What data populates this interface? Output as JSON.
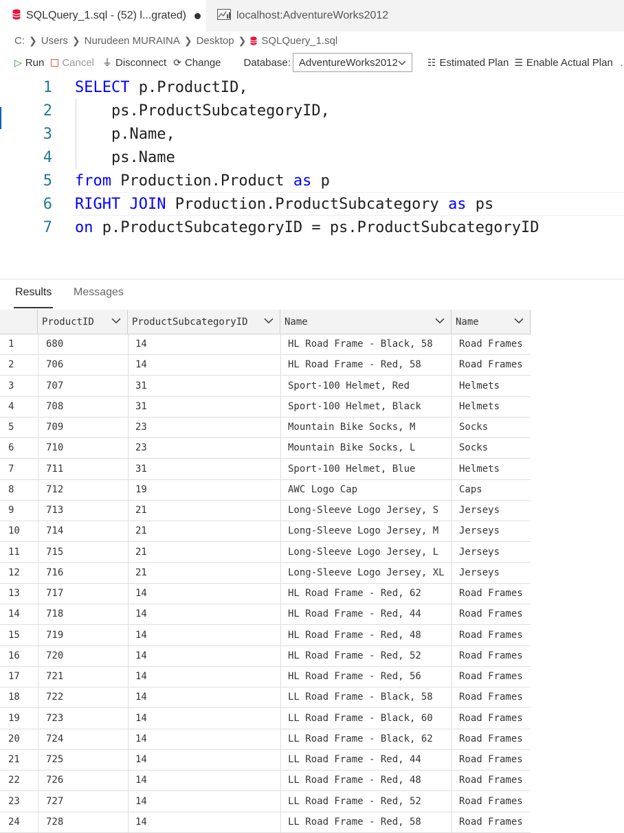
{
  "tabs": [
    {
      "label": "SQLQuery_1.sql - (52) l...grated)",
      "icon": "database-icon",
      "active": true
    },
    {
      "label": "localhost:AdventureWorks2012",
      "icon": "dashboard-icon",
      "active": false
    }
  ],
  "breadcrumb": [
    "C:",
    "Users",
    "Nurudeen MURAINA",
    "Desktop",
    "SQLQuery_1.sql"
  ],
  "toolbar": {
    "run": "Run",
    "cancel": "Cancel",
    "disconnect": "Disconnect",
    "change": "Change",
    "database_label": "Database:",
    "database_value": "AdventureWorks2012",
    "estimated_plan": "Estimated Plan",
    "enable_actual_plan": "Enable Actual Plan"
  },
  "editor": {
    "lines": [
      {
        "num": "1",
        "tokens": [
          {
            "t": "SELECT",
            "kw": true
          },
          {
            "t": " p.ProductID,",
            "kw": false
          }
        ]
      },
      {
        "num": "2",
        "tokens": [
          {
            "t": "    ps.ProductSubcategoryID,",
            "kw": false
          }
        ]
      },
      {
        "num": "3",
        "tokens": [
          {
            "t": "    p.Name,",
            "kw": false
          }
        ]
      },
      {
        "num": "4",
        "tokens": [
          {
            "t": "    ps.Name",
            "kw": false
          }
        ]
      },
      {
        "num": "5",
        "tokens": [
          {
            "t": "from",
            "kw": true
          },
          {
            "t": " Production.Product ",
            "kw": false
          },
          {
            "t": "as",
            "kw": true
          },
          {
            "t": " p",
            "kw": false
          }
        ]
      },
      {
        "num": "6",
        "tokens": [
          {
            "t": "RIGHT JOIN",
            "kw": true
          },
          {
            "t": " Production.ProductSubcategory ",
            "kw": false
          },
          {
            "t": "as",
            "kw": true
          },
          {
            "t": " ps",
            "kw": false
          }
        ]
      },
      {
        "num": "7",
        "tokens": [
          {
            "t": "on",
            "kw": true
          },
          {
            "t": " p.ProductSubcategoryID = ps.ProductSubcategoryID",
            "kw": false
          }
        ]
      }
    ]
  },
  "results": {
    "tabs": [
      "Results",
      "Messages"
    ],
    "columns": [
      "ProductID",
      "ProductSubcategoryID",
      "Name",
      "Name"
    ],
    "rows": [
      [
        "1",
        "680",
        "14",
        "HL Road Frame - Black, 58",
        "Road Frames"
      ],
      [
        "2",
        "706",
        "14",
        "HL Road Frame - Red, 58",
        "Road Frames"
      ],
      [
        "3",
        "707",
        "31",
        "Sport-100 Helmet, Red",
        "Helmets"
      ],
      [
        "4",
        "708",
        "31",
        "Sport-100 Helmet, Black",
        "Helmets"
      ],
      [
        "5",
        "709",
        "23",
        "Mountain Bike Socks, M",
        "Socks"
      ],
      [
        "6",
        "710",
        "23",
        "Mountain Bike Socks, L",
        "Socks"
      ],
      [
        "7",
        "711",
        "31",
        "Sport-100 Helmet, Blue",
        "Helmets"
      ],
      [
        "8",
        "712",
        "19",
        "AWC Logo Cap",
        "Caps"
      ],
      [
        "9",
        "713",
        "21",
        "Long-Sleeve Logo Jersey, S",
        "Jerseys"
      ],
      [
        "10",
        "714",
        "21",
        "Long-Sleeve Logo Jersey, M",
        "Jerseys"
      ],
      [
        "11",
        "715",
        "21",
        "Long-Sleeve Logo Jersey, L",
        "Jerseys"
      ],
      [
        "12",
        "716",
        "21",
        "Long-Sleeve Logo Jersey, XL",
        "Jerseys"
      ],
      [
        "13",
        "717",
        "14",
        "HL Road Frame - Red, 62",
        "Road Frames"
      ],
      [
        "14",
        "718",
        "14",
        "HL Road Frame - Red, 44",
        "Road Frames"
      ],
      [
        "15",
        "719",
        "14",
        "HL Road Frame - Red, 48",
        "Road Frames"
      ],
      [
        "16",
        "720",
        "14",
        "HL Road Frame - Red, 52",
        "Road Frames"
      ],
      [
        "17",
        "721",
        "14",
        "HL Road Frame - Red, 56",
        "Road Frames"
      ],
      [
        "18",
        "722",
        "14",
        "LL Road Frame - Black, 58",
        "Road Frames"
      ],
      [
        "19",
        "723",
        "14",
        "LL Road Frame - Black, 60",
        "Road Frames"
      ],
      [
        "20",
        "724",
        "14",
        "LL Road Frame - Black, 62",
        "Road Frames"
      ],
      [
        "21",
        "725",
        "14",
        "LL Road Frame - Red, 44",
        "Road Frames"
      ],
      [
        "22",
        "726",
        "14",
        "LL Road Frame - Red, 48",
        "Road Frames"
      ],
      [
        "23",
        "727",
        "14",
        "LL Road Frame - Red, 52",
        "Road Frames"
      ],
      [
        "24",
        "728",
        "14",
        "LL Road Frame - Red, 58",
        "Road Frames"
      ]
    ]
  },
  "colors": {
    "keyword": "#0000ff",
    "line_number": "#237893",
    "run_icon": "#388a34",
    "cancel_icon": "#e51400",
    "database_icon": "#e5163e"
  }
}
